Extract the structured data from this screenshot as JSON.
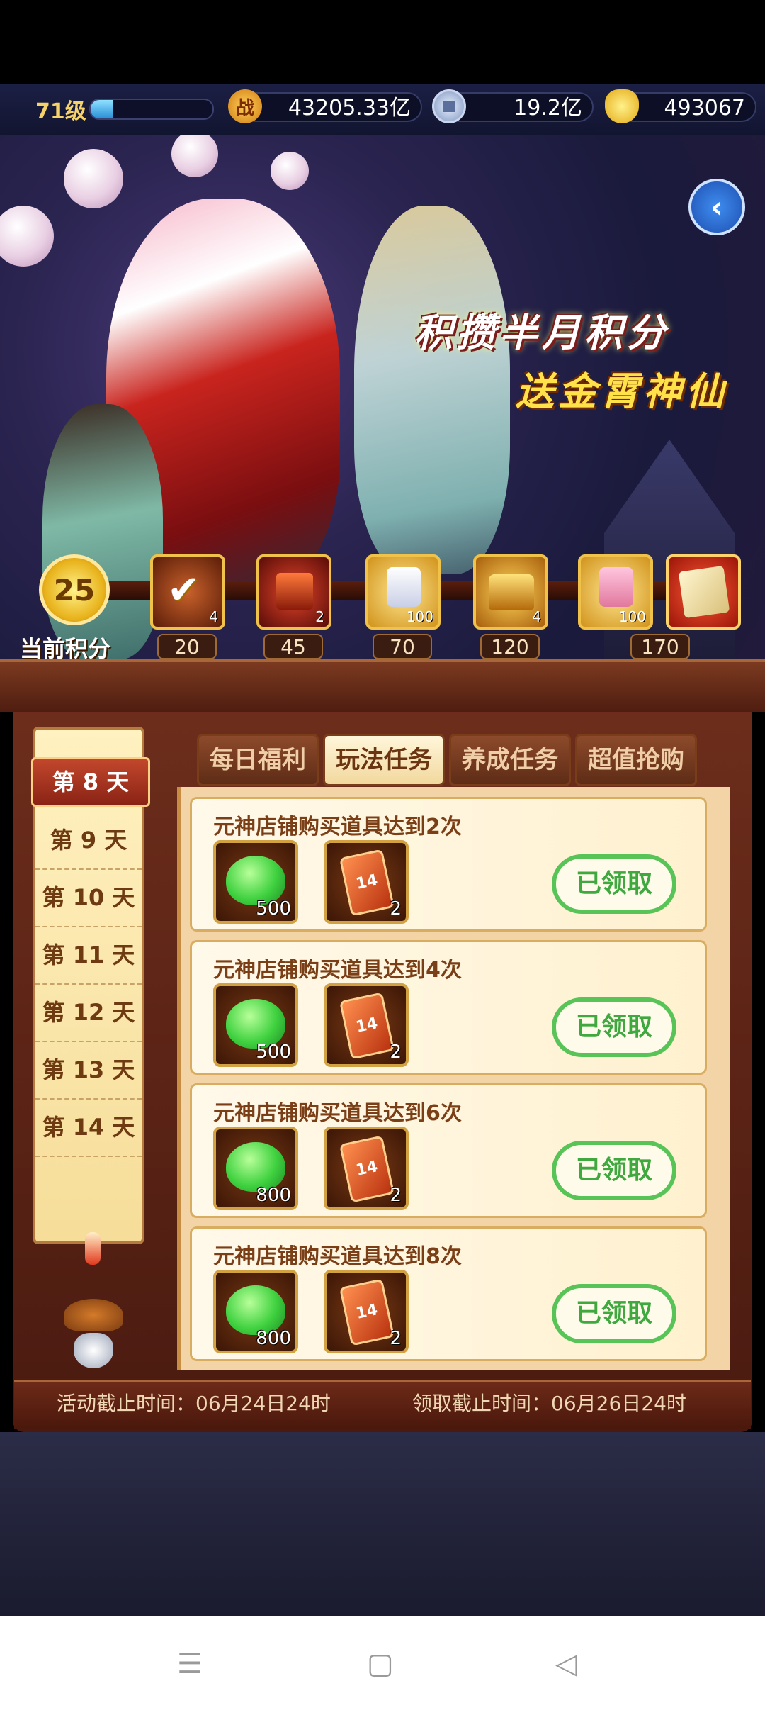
{
  "topbar": {
    "level": "71级",
    "xp_fraction": 0.18,
    "combat_icon": "战",
    "combat_power": "43205.33亿",
    "silver": "19.2亿",
    "gold": "493067"
  },
  "banner": {
    "title_line1": "积攒半月积分",
    "title_line2": "送金霄神仙"
  },
  "progress": {
    "current_score": "25",
    "current_label": "当前积分",
    "milestones": [
      {
        "threshold": "20",
        "count": "4",
        "icon": "checkmark-chest-icon"
      },
      {
        "threshold": "45",
        "count": "2",
        "icon": "red-gift-icon"
      },
      {
        "threshold": "70",
        "count": "100",
        "icon": "character-shard-icon"
      },
      {
        "threshold": "120",
        "count": "4",
        "icon": "gold-chest-icon"
      },
      {
        "threshold": "",
        "count": "100",
        "icon": "pink-shard-icon"
      },
      {
        "threshold": "170",
        "count": "",
        "icon": "map-scroll-icon"
      }
    ]
  },
  "days": {
    "active": "第 8 天",
    "items": [
      "第 9 天",
      "第 10 天",
      "第 11 天",
      "第 12 天",
      "第 13 天",
      "第 14 天"
    ]
  },
  "tabs": [
    "每日福利",
    "玩法任务",
    "养成任务",
    "超值抢购"
  ],
  "tasks": [
    {
      "title": "元神店铺购买道具达到2次",
      "jade_qty": "500",
      "ticket_qty": "2",
      "status": "已领取"
    },
    {
      "title": "元神店铺购买道具达到4次",
      "jade_qty": "500",
      "ticket_qty": "2",
      "status": "已领取"
    },
    {
      "title": "元神店铺购买道具达到6次",
      "jade_qty": "800",
      "ticket_qty": "2",
      "status": "已领取"
    },
    {
      "title": "元神店铺购买道具达到8次",
      "jade_qty": "800",
      "ticket_qty": "2",
      "status": "已领取"
    }
  ],
  "ticket_label": "14",
  "footer": {
    "event_deadline": "活动截止时间：06月24日24时",
    "claim_deadline": "领取截止时间：06月26日24时"
  },
  "nav": {
    "menu_glyph": "☰",
    "home_glyph": "▢",
    "back_glyph": "◁"
  }
}
